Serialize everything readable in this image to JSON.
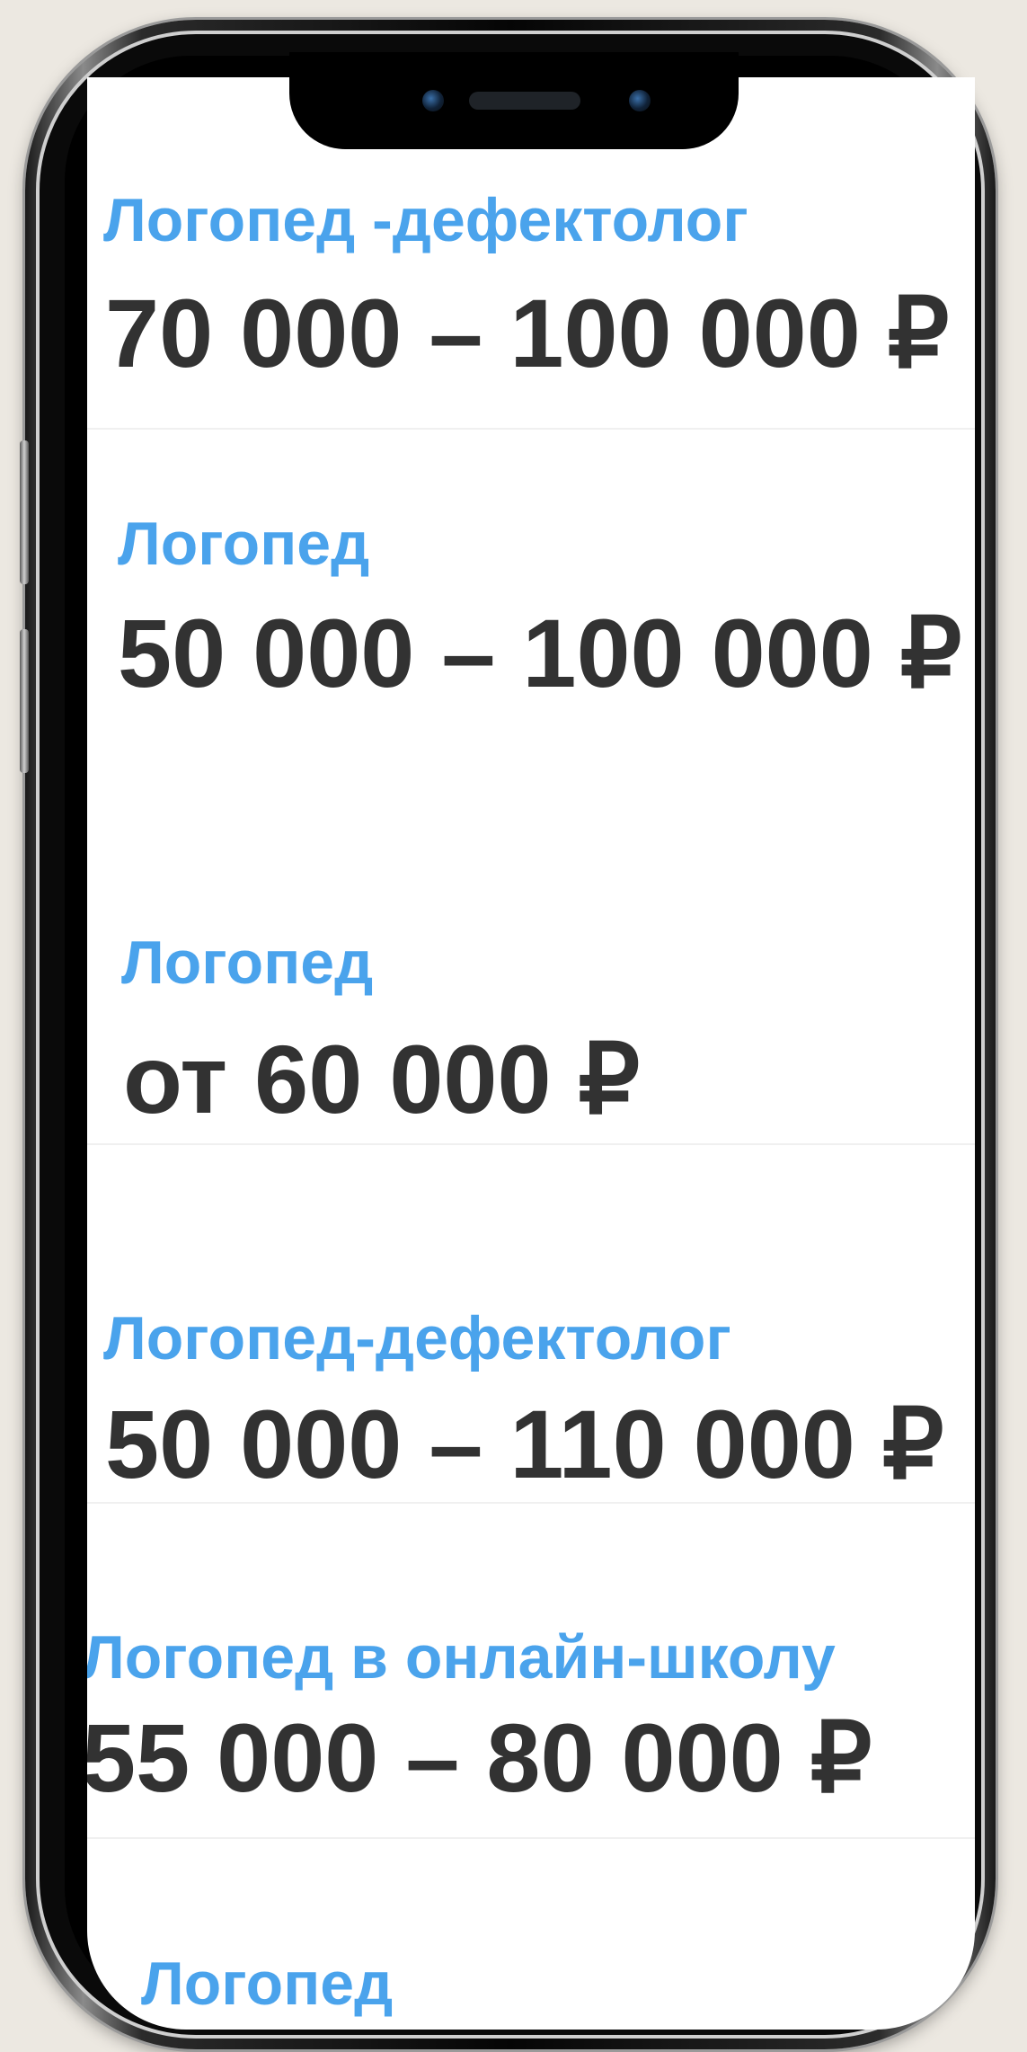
{
  "listings": [
    {
      "title": "Логопед -дефектолог",
      "salary": "70 000 – 100 000 ₽"
    },
    {
      "title": "Логопед",
      "salary": "50 000 – 100 000 ₽"
    },
    {
      "title": "Логопед",
      "salary": "от 60 000 ₽"
    },
    {
      "title": "Логопед-дефектолог",
      "salary": "50 000 – 110 000 ₽"
    },
    {
      "title": "Логопед в онлайн-школу",
      "salary": "55 000 – 80 000 ₽"
    },
    {
      "title": "Логопед",
      "salary": ""
    }
  ],
  "colors": {
    "title": "#4aa3ec",
    "salary": "#323232",
    "background": "#ece8e1"
  }
}
